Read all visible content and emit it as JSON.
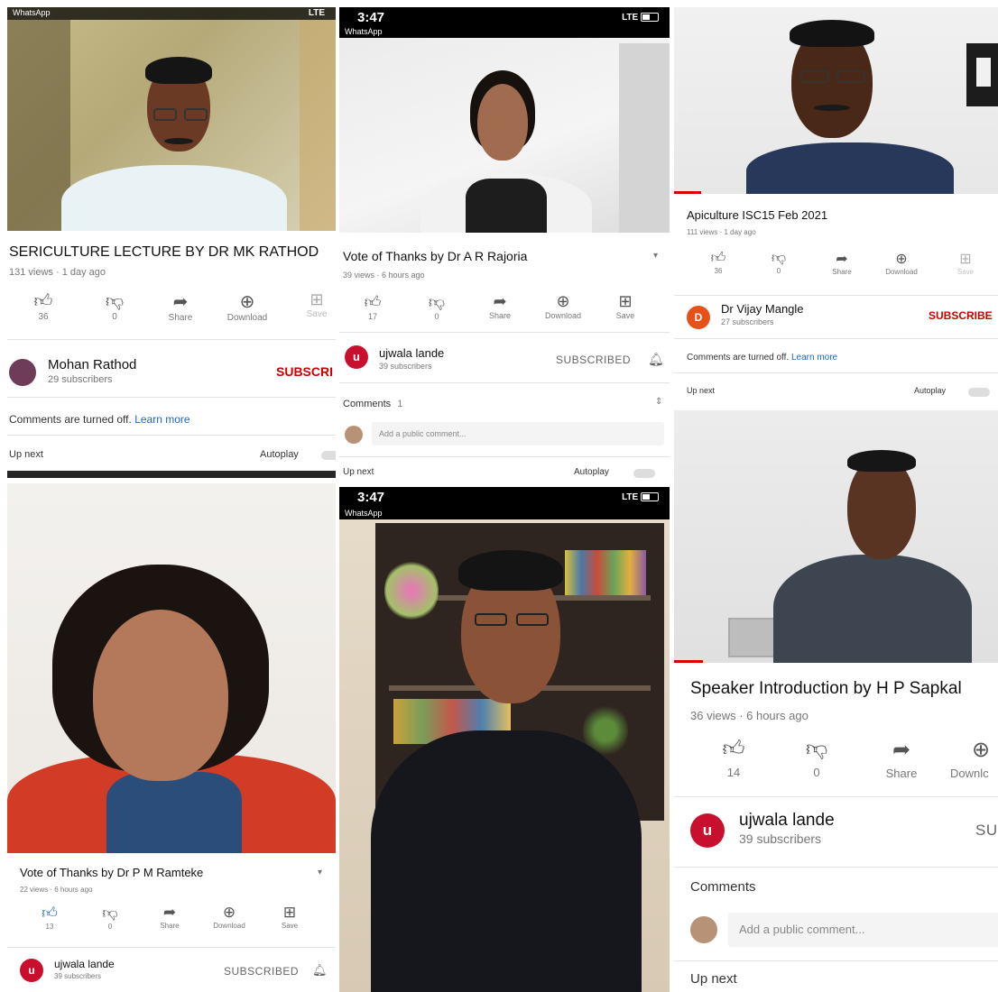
{
  "colors": {
    "youtube_red": "#cc0000",
    "link_blue": "#1a66c8",
    "avatar_red": "#c8102e",
    "avatar_orange": "#e8501a"
  },
  "p1": {
    "status": {
      "app": "WhatsApp",
      "signal": "LTE"
    },
    "title": "SERICULTURE LECTURE BY DR  MK RATHOD",
    "meta": "131 views · 1 day ago",
    "actions": [
      {
        "icon": "thumb-up-icon",
        "label": "36"
      },
      {
        "icon": "thumb-down-icon",
        "label": "0"
      },
      {
        "icon": "share-icon",
        "label": "Share"
      },
      {
        "icon": "download-icon",
        "label": "Download"
      },
      {
        "icon": "save-icon",
        "label": "Save"
      }
    ],
    "channel": {
      "name": "Mohan Rathod",
      "subs": "29 subscribers",
      "subscribe": "SUBSCRI"
    },
    "comments_off": "Comments are turned off.",
    "learn_more": "Learn more",
    "up_next": "Up next",
    "autoplay": "Autoplay"
  },
  "p2": {
    "status": {
      "time": "3:47",
      "app": "WhatsApp",
      "signal": "LTE"
    },
    "title": "Vote of Thanks by Dr A R Rajoria",
    "meta": "39 views · 6 hours ago",
    "actions": [
      {
        "icon": "thumb-up-icon",
        "label": "17"
      },
      {
        "icon": "thumb-down-icon",
        "label": "0"
      },
      {
        "icon": "share-icon",
        "label": "Share"
      },
      {
        "icon": "download-icon",
        "label": "Download"
      },
      {
        "icon": "save-icon",
        "label": "Save"
      }
    ],
    "channel": {
      "avatar": "u",
      "name": "ujwala lande",
      "subs": "39 subscribers",
      "subscribe": "SUBSCRIBED"
    },
    "comments_label": "Comments",
    "comments_count": "1",
    "comment_placeholder": "Add a public comment...",
    "up_next": "Up next",
    "autoplay": "Autoplay"
  },
  "p3": {
    "title": "Apiculture ISC15 Feb 2021",
    "meta": "111 views · 1 day ago",
    "actions": [
      {
        "icon": "thumb-up-icon",
        "label": "36"
      },
      {
        "icon": "thumb-down-icon",
        "label": "0"
      },
      {
        "icon": "share-icon",
        "label": "Share"
      },
      {
        "icon": "download-icon",
        "label": "Download"
      },
      {
        "icon": "save-icon",
        "label": "Save"
      }
    ],
    "channel": {
      "avatar": "D",
      "name": "Dr Vijay Mangle",
      "subs": "27 subscribers",
      "subscribe": "SUBSCRIBE"
    },
    "comments_off": "Comments are turned off.",
    "learn_more": "Learn more",
    "up_next": "Up next",
    "autoplay": "Autoplay"
  },
  "p4": {
    "title": "Vote of Thanks by Dr P M Ramteke",
    "meta": "22 views · 6 hours ago",
    "actions": [
      {
        "icon": "thumb-up-icon",
        "label": "13"
      },
      {
        "icon": "thumb-down-icon",
        "label": "0"
      },
      {
        "icon": "share-icon",
        "label": "Share"
      },
      {
        "icon": "download-icon",
        "label": "Download"
      },
      {
        "icon": "save-icon",
        "label": "Save"
      }
    ],
    "channel": {
      "avatar": "u",
      "name": "ujwala lande",
      "subs": "39 subscribers",
      "subscribe": "SUBSCRIBED"
    }
  },
  "p5": {
    "status": {
      "time": "3:47",
      "app": "WhatsApp",
      "signal": "LTE"
    }
  },
  "p6": {
    "title": "Speaker Introduction by H P Sapkal",
    "meta": "36 views · 6 hours ago",
    "actions": [
      {
        "icon": "thumb-up-icon",
        "label": "14"
      },
      {
        "icon": "thumb-down-icon",
        "label": "0"
      },
      {
        "icon": "share-icon",
        "label": "Share"
      },
      {
        "icon": "download-icon",
        "label": "Downlc"
      }
    ],
    "channel": {
      "avatar": "u",
      "name": "ujwala lande",
      "subs": "39 subscribers",
      "subscribe": "SU"
    },
    "comments_label": "Comments",
    "comment_placeholder": "Add a public comment...",
    "up_next": "Up next"
  }
}
